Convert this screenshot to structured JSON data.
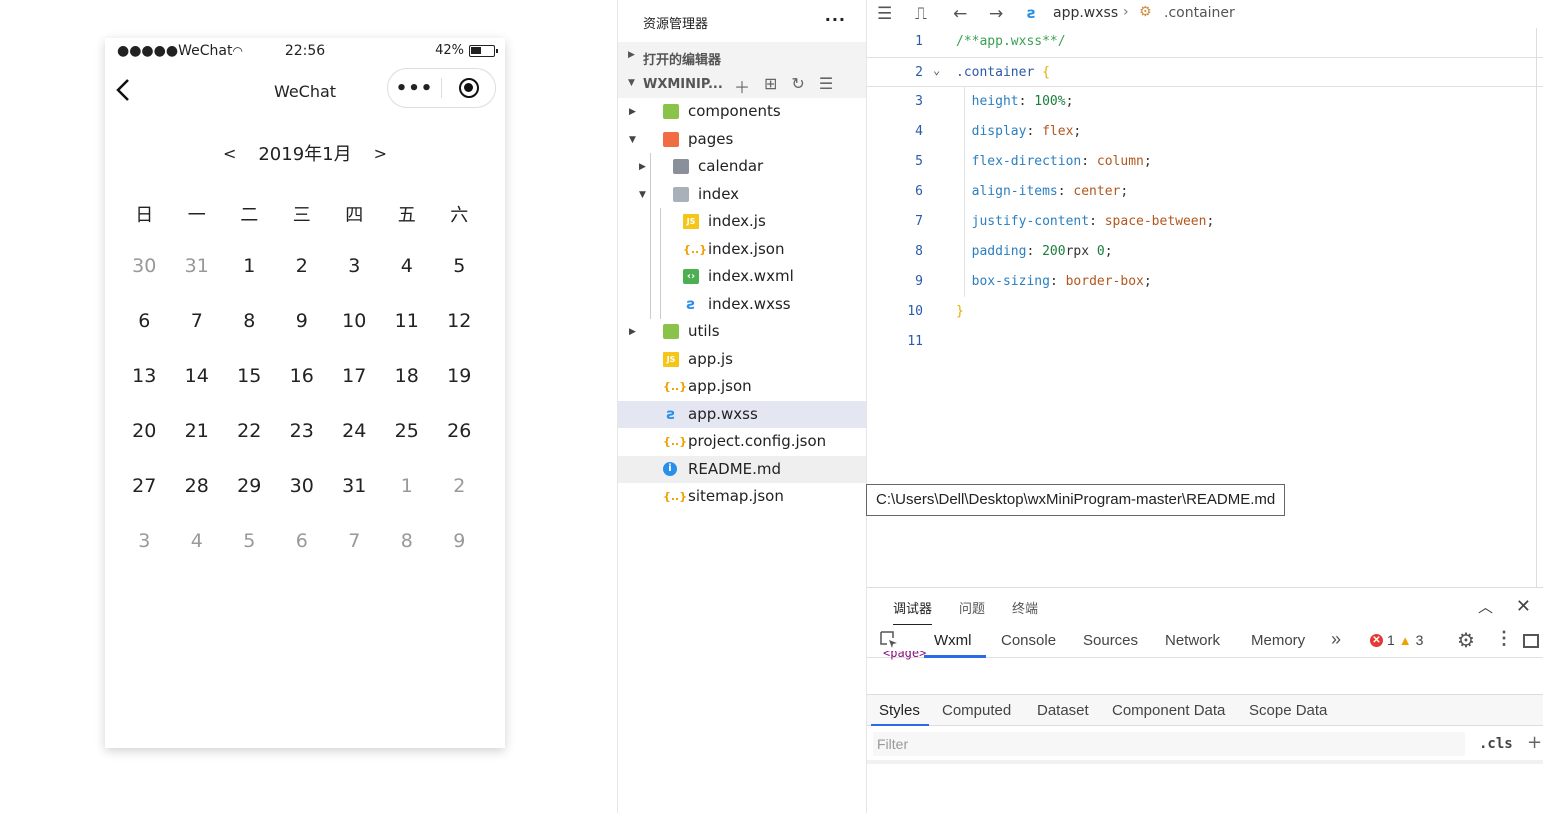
{
  "simulator": {
    "status": {
      "carrier": "WeChat",
      "signal_dots": "●●●●●",
      "time": "22:56",
      "battery": "42%"
    },
    "nav": {
      "title": "WeChat",
      "back_icon": "chevron-left-icon",
      "more_label": "•••"
    },
    "calendar": {
      "prev": "<",
      "next": ">",
      "month": "2019年1月",
      "weekdays": [
        "日",
        "一",
        "二",
        "三",
        "四",
        "五",
        "六"
      ],
      "days": [
        {
          "d": "30",
          "other": true
        },
        {
          "d": "31",
          "other": true
        },
        {
          "d": "1"
        },
        {
          "d": "2"
        },
        {
          "d": "3"
        },
        {
          "d": "4"
        },
        {
          "d": "5"
        },
        {
          "d": "6"
        },
        {
          "d": "7"
        },
        {
          "d": "8"
        },
        {
          "d": "9"
        },
        {
          "d": "10"
        },
        {
          "d": "11"
        },
        {
          "d": "12"
        },
        {
          "d": "13"
        },
        {
          "d": "14"
        },
        {
          "d": "15"
        },
        {
          "d": "16"
        },
        {
          "d": "17"
        },
        {
          "d": "18"
        },
        {
          "d": "19"
        },
        {
          "d": "20"
        },
        {
          "d": "21"
        },
        {
          "d": "22"
        },
        {
          "d": "23"
        },
        {
          "d": "24"
        },
        {
          "d": "25"
        },
        {
          "d": "26"
        },
        {
          "d": "27"
        },
        {
          "d": "28"
        },
        {
          "d": "29"
        },
        {
          "d": "30"
        },
        {
          "d": "31"
        },
        {
          "d": "1",
          "other": true
        },
        {
          "d": "2",
          "other": true
        },
        {
          "d": "3",
          "other": true
        },
        {
          "d": "4",
          "other": true
        },
        {
          "d": "5",
          "other": true
        },
        {
          "d": "6",
          "other": true
        },
        {
          "d": "7",
          "other": true
        },
        {
          "d": "8",
          "other": true
        },
        {
          "d": "9",
          "other": true
        }
      ]
    }
  },
  "explorer": {
    "title": "资源管理器",
    "more": "···",
    "open_editors": "打开的编辑器",
    "project": "WXMINIP...",
    "tree": [
      {
        "name": "components",
        "icon": "folder-green",
        "depth": 0,
        "caret": "▶"
      },
      {
        "name": "pages",
        "icon": "folder-orange",
        "depth": 0,
        "caret": "▼"
      },
      {
        "name": "calendar",
        "icon": "folder-gray",
        "depth": 1,
        "caret": "▶"
      },
      {
        "name": "index",
        "icon": "folder-open",
        "depth": 1,
        "caret": "▼"
      },
      {
        "name": "index.js",
        "icon": "js",
        "depth": 2
      },
      {
        "name": "index.json",
        "icon": "json",
        "depth": 2
      },
      {
        "name": "index.wxml",
        "icon": "wxml",
        "depth": 2
      },
      {
        "name": "index.wxss",
        "icon": "wxss",
        "depth": 2
      },
      {
        "name": "utils",
        "icon": "folder-green",
        "depth": 0,
        "caret": "▶"
      },
      {
        "name": "app.js",
        "icon": "js",
        "depth": 0
      },
      {
        "name": "app.json",
        "icon": "json",
        "depth": 0
      },
      {
        "name": "app.wxss",
        "icon": "wxss",
        "depth": 0,
        "selected": true
      },
      {
        "name": "project.config.json",
        "icon": "json",
        "depth": 0
      },
      {
        "name": "README.md",
        "icon": "info",
        "depth": 0,
        "hovered": true
      },
      {
        "name": "sitemap.json",
        "icon": "json",
        "depth": 0
      }
    ]
  },
  "editor": {
    "breadcrumb": {
      "file": "app.wxss",
      "selector": ".container"
    },
    "lines": [
      {
        "n": "1",
        "tokens": [
          [
            "c-comment",
            "/**app.wxss**/"
          ]
        ]
      },
      {
        "n": "2",
        "fold": true,
        "tokens": [
          [
            "c-selector",
            ".container"
          ],
          [
            "c-punct",
            " "
          ],
          [
            "c-brace",
            "{"
          ]
        ]
      },
      {
        "n": "3",
        "tokens": [
          [
            "c-punct",
            "  "
          ],
          [
            "c-prop",
            "height"
          ],
          [
            "c-punct",
            ": "
          ],
          [
            "c-num",
            "100%"
          ],
          [
            "c-punct",
            ";"
          ]
        ]
      },
      {
        "n": "4",
        "tokens": [
          [
            "c-punct",
            "  "
          ],
          [
            "c-prop",
            "display"
          ],
          [
            "c-punct",
            ": "
          ],
          [
            "c-val",
            "flex"
          ],
          [
            "c-punct",
            ";"
          ]
        ]
      },
      {
        "n": "5",
        "tokens": [
          [
            "c-punct",
            "  "
          ],
          [
            "c-prop",
            "flex-direction"
          ],
          [
            "c-punct",
            ": "
          ],
          [
            "c-val",
            "column"
          ],
          [
            "c-punct",
            ";"
          ]
        ]
      },
      {
        "n": "6",
        "tokens": [
          [
            "c-punct",
            "  "
          ],
          [
            "c-prop",
            "align-items"
          ],
          [
            "c-punct",
            ": "
          ],
          [
            "c-val",
            "center"
          ],
          [
            "c-punct",
            ";"
          ]
        ]
      },
      {
        "n": "7",
        "tokens": [
          [
            "c-punct",
            "  "
          ],
          [
            "c-prop",
            "justify-content"
          ],
          [
            "c-punct",
            ": "
          ],
          [
            "c-val",
            "space-between"
          ],
          [
            "c-punct",
            ";"
          ]
        ]
      },
      {
        "n": "8",
        "tokens": [
          [
            "c-punct",
            "  "
          ],
          [
            "c-prop",
            "padding"
          ],
          [
            "c-punct",
            ": "
          ],
          [
            "c-num",
            "200"
          ],
          [
            "c-punct",
            "rpx "
          ],
          [
            "c-num",
            "0"
          ],
          [
            "c-punct",
            ";"
          ]
        ]
      },
      {
        "n": "9",
        "tokens": [
          [
            "c-punct",
            "  "
          ],
          [
            "c-prop",
            "box-sizing"
          ],
          [
            "c-punct",
            ": "
          ],
          [
            "c-val",
            "border-box"
          ],
          [
            "c-punct",
            ";"
          ]
        ]
      },
      {
        "n": "10",
        "tokens": [
          [
            "c-brace",
            "}"
          ]
        ]
      },
      {
        "n": "11",
        "tokens": []
      }
    ]
  },
  "tooltip": "C:\\Users\\Dell\\Desktop\\wxMiniProgram-master\\README.md",
  "debugger": {
    "tabs": [
      "调试器",
      "问题",
      "终端"
    ],
    "collapse": "︿",
    "close": "✕",
    "devtools_tabs": [
      "Wxml",
      "Console",
      "Sources",
      "Network",
      "Memory"
    ],
    "more_tabs": "»",
    "errors": "1",
    "warnings": "3",
    "dom_snippet": "<page>",
    "style_tabs": [
      "Styles",
      "Computed",
      "Dataset",
      "Component Data",
      "Scope Data"
    ],
    "filter_placeholder": "Filter",
    "cls": ".cls",
    "add": "+"
  }
}
